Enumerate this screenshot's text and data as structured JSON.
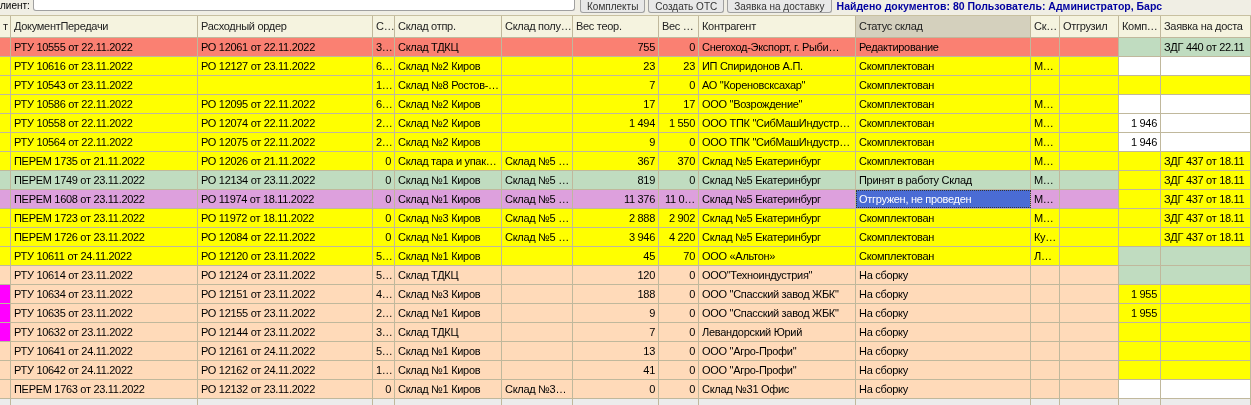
{
  "toolbar": {
    "label": "лиент:",
    "buttons": [
      "Комплекты",
      "Создать ОТС",
      "Заявка на доставку"
    ],
    "info": "Найдено документов: 80  Пользователь: Администратор, Барс"
  },
  "table": {
    "columns": [
      {
        "label": "т",
        "sorted": false
      },
      {
        "label": "ДокументПередачи",
        "sorted": false
      },
      {
        "label": "Расходный ордер",
        "sorted": false
      },
      {
        "label": "С…",
        "sorted": false
      },
      {
        "label": "Склад отпр.",
        "sorted": false
      },
      {
        "label": "Склад полу…",
        "sorted": false
      },
      {
        "label": "Вес теор.",
        "sorted": false
      },
      {
        "label": "Вес …",
        "sorted": false
      },
      {
        "label": "Контрагент",
        "sorted": false
      },
      {
        "label": "Статус склад",
        "sorted": true
      },
      {
        "label": "Ск…",
        "sorted": false
      },
      {
        "label": "Отгрузил",
        "sorted": false
      },
      {
        "label": "Комп…",
        "sorted": false
      },
      {
        "label": "Заявка на доста",
        "sorted": false
      }
    ],
    "rows": [
      {
        "color": "#fa8072",
        "marked": false,
        "komp_cell": {
          "color": "#c0dcc0"
        },
        "request_cell": {
          "color": "#c0dcc0"
        },
        "selected": false,
        "cells": [
          null,
          "РТУ 10555 от 22.11.2022",
          "РО 12061 от 22.11.2022",
          "3…",
          "Склад ТДКЦ",
          null,
          "755",
          "0",
          "Снегоход-Экспорт, г. Рыби…",
          "Редактирование",
          null,
          null,
          null,
          "ЗДГ 440 от 22.11"
        ]
      },
      {
        "color": "#ffff00",
        "marked": false,
        "komp_cell": {
          "color": "#ffffff"
        },
        "request_cell": {
          "color": "#ffffff"
        },
        "selected": false,
        "cells": [
          null,
          "РТУ 10616 от 23.11.2022",
          "РО 12127 от 23.11.2022",
          "6…",
          "Склад №2 Киров",
          null,
          "23",
          "23",
          "ИП Спиридонов А.П.",
          "Скомплектован",
          "М…",
          null,
          null,
          null
        ]
      },
      {
        "color": "#ffff00",
        "marked": false,
        "komp_cell": {
          "color": "#ffff00"
        },
        "request_cell": {
          "color": "#ffff00"
        },
        "selected": false,
        "cells": [
          null,
          "РТУ 10543 от 23.11.2022",
          null,
          "1…",
          "Склад №8 Ростов-…",
          null,
          "7",
          "0",
          "АО \"Кореновсксахар\"",
          "Скомплектован",
          null,
          null,
          null,
          null
        ]
      },
      {
        "color": "#ffff00",
        "marked": false,
        "komp_cell": {
          "color": "#ffffff"
        },
        "request_cell": {
          "color": "#ffffff"
        },
        "selected": false,
        "cells": [
          null,
          "РТУ 10586 от 22.11.2022",
          "РО 12095 от 22.11.2022",
          "6…",
          "Склад №2 Киров",
          null,
          "17",
          "17",
          "ООО \"Возрождение\"",
          "Скомплектован",
          "М…",
          null,
          null,
          null
        ]
      },
      {
        "color": "#ffff00",
        "marked": false,
        "komp_cell": {
          "color": "#ffffff"
        },
        "request_cell": {
          "color": "#ffffff"
        },
        "selected": false,
        "cells": [
          null,
          "РТУ 10558 от 22.11.2022",
          "РО 12074 от 22.11.2022",
          "2…",
          "Склад №2 Киров",
          null,
          "1 494",
          "1 550",
          "ООО ТПК \"СибМашИндустр…",
          "Скомплектован",
          "М…",
          null,
          "1 946",
          null
        ]
      },
      {
        "color": "#ffff00",
        "marked": false,
        "komp_cell": {
          "color": "#ffffff"
        },
        "request_cell": {
          "color": "#ffffff"
        },
        "selected": false,
        "cells": [
          null,
          "РТУ 10564 от 22.11.2022",
          "РО 12075 от 22.11.2022",
          "2…",
          "Склад №2 Киров",
          null,
          "9",
          "0",
          "ООО ТПК \"СибМашИндустр…",
          "Скомплектован",
          "М…",
          null,
          "1 946",
          null
        ]
      },
      {
        "color": "#ffff00",
        "marked": false,
        "komp_cell": {
          "color": "#ffff00"
        },
        "request_cell": {
          "color": "#ffff00"
        },
        "selected": false,
        "cells": [
          null,
          "ПЕРЕМ 1735 от 21.11.2022",
          "РО 12026 от 21.11.2022",
          "0",
          "Склад тара и упак…",
          "Склад №5 …",
          "367",
          "370",
          "Склад №5 Екатеринбург",
          "Скомплектован",
          "М…",
          null,
          null,
          "ЗДГ 437 от 18.11"
        ]
      },
      {
        "color": "#c0dcc0",
        "marked": false,
        "komp_cell": {
          "color": "#ffff00"
        },
        "request_cell": {
          "color": "#ffff00"
        },
        "selected": false,
        "cells": [
          null,
          "ПЕРЕМ 1749 от 23.11.2022",
          "РО 12134 от 23.11.2022",
          "0",
          "Склад №1 Киров",
          "Склад №5 …",
          "819",
          "0",
          "Склад №5 Екатеринбург",
          "Принят в работу Склад",
          "М…",
          null,
          null,
          "ЗДГ 437 от 18.11"
        ]
      },
      {
        "color": "#dda0dd",
        "marked": false,
        "komp_cell": {
          "color": "#ffff00"
        },
        "request_cell": {
          "color": "#ffff00"
        },
        "selected": true,
        "cells": [
          null,
          "ПЕРЕМ 1608 от 23.11.2022",
          "РО 11974 от 18.11.2022",
          "0",
          "Склад №1 Киров",
          "Склад №5 …",
          "11 376",
          "11 0…",
          "Склад №5 Екатеринбург",
          "Отгружен, не проведен",
          "М…",
          null,
          null,
          "ЗДГ 437 от 18.11"
        ]
      },
      {
        "color": "#ffff00",
        "marked": false,
        "komp_cell": {
          "color": "#ffff00"
        },
        "request_cell": {
          "color": "#ffff00"
        },
        "selected": false,
        "cells": [
          null,
          "ПЕРЕМ 1723 от 23.11.2022",
          "РО 11972 от 18.11.2022",
          "0",
          "Склад №3 Киров",
          "Склад №5 …",
          "2 888",
          "2 902",
          "Склад №5 Екатеринбург",
          "Скомплектован",
          "М…",
          null,
          null,
          "ЗДГ 437 от 18.11"
        ]
      },
      {
        "color": "#ffff00",
        "marked": false,
        "komp_cell": {
          "color": "#ffff00"
        },
        "request_cell": {
          "color": "#ffff00"
        },
        "selected": false,
        "cells": [
          null,
          "ПЕРЕМ 1726 от 23.11.2022",
          "РО 12084 от 22.11.2022",
          "0",
          "Склад №1 Киров",
          "Склад №5 …",
          "3 946",
          "4 220",
          "Склад №5 Екатеринбург",
          "Скомплектован",
          "Ку…",
          null,
          null,
          "ЗДГ 437 от 18.11"
        ]
      },
      {
        "color": "#ffff00",
        "marked": false,
        "komp_cell": {
          "color": "#c0dcc0"
        },
        "request_cell": {
          "color": "#c0dcc0"
        },
        "selected": false,
        "cells": [
          null,
          "РТУ 10611 от 24.11.2022",
          "РО 12120 от 23.11.2022",
          "5…",
          "Склад №1 Киров",
          null,
          "45",
          "70",
          "ООО «Альтон»",
          "Скомплектован",
          "Л…",
          null,
          null,
          null
        ]
      },
      {
        "color": "#ffdab9",
        "marked": false,
        "komp_cell": {
          "color": "#c0dcc0"
        },
        "request_cell": {
          "color": "#c0dcc0"
        },
        "selected": false,
        "cells": [
          null,
          "РТУ 10614 от 23.11.2022",
          "РО 12124 от 23.11.2022",
          "5…",
          "Склад ТДКЦ",
          null,
          "120",
          "0",
          "ООО\"Техноиндустрия\"",
          "На сборку",
          null,
          null,
          null,
          null
        ]
      },
      {
        "color": "#ffdab9",
        "marked": true,
        "komp_cell": {
          "color": "#ffff00"
        },
        "request_cell": {
          "color": "#ffff00"
        },
        "selected": false,
        "cells": [
          null,
          "РТУ 10634 от 23.11.2022",
          "РО 12151 от 23.11.2022",
          "4…",
          "Склад №3 Киров",
          null,
          "188",
          "0",
          "ООО \"Спасский завод ЖБК\"",
          "На сборку",
          null,
          null,
          "1 955",
          null
        ]
      },
      {
        "color": "#ffdab9",
        "marked": true,
        "komp_cell": {
          "color": "#ffff00"
        },
        "request_cell": {
          "color": "#ffff00"
        },
        "selected": false,
        "cells": [
          null,
          "РТУ 10635 от 23.11.2022",
          "РО 12155 от 23.11.2022",
          "2…",
          "Склад №1 Киров",
          null,
          "9",
          "0",
          "ООО \"Спасский завод ЖБК\"",
          "На сборку",
          null,
          null,
          "1 955",
          null
        ]
      },
      {
        "color": "#ffdab9",
        "marked": true,
        "komp_cell": {
          "color": "#ffff00"
        },
        "request_cell": {
          "color": "#ffff00"
        },
        "selected": false,
        "cells": [
          null,
          "РТУ 10632 от 23.11.2022",
          "РО 12144 от 23.11.2022",
          "3…",
          "Склад ТДКЦ",
          null,
          "7",
          "0",
          "Левандорский Юрий",
          "На сборку",
          null,
          null,
          null,
          null
        ]
      },
      {
        "color": "#ffdab9",
        "marked": false,
        "komp_cell": {
          "color": "#ffff00"
        },
        "request_cell": {
          "color": "#ffff00"
        },
        "selected": false,
        "cells": [
          null,
          "РТУ 10641 от 24.11.2022",
          "РО 12161 от 24.11.2022",
          "5…",
          "Склад №1 Киров",
          null,
          "13",
          "0",
          "ООО \"Агро-Профи\"",
          "На сборку",
          null,
          null,
          null,
          null
        ]
      },
      {
        "color": "#ffdab9",
        "marked": false,
        "komp_cell": {
          "color": "#ffff00"
        },
        "request_cell": {
          "color": "#ffff00"
        },
        "selected": false,
        "cells": [
          null,
          "РТУ 10642 от 24.11.2022",
          "РО 12162 от 24.11.2022",
          "1…",
          "Склад №1 Киров",
          null,
          "41",
          "0",
          "ООО \"Агро-Профи\"",
          "На сборку",
          null,
          null,
          null,
          null
        ]
      },
      {
        "color": "#ffdab9",
        "marked": false,
        "komp_cell": {
          "color": "#ffffff"
        },
        "request_cell": {
          "color": "#ffffff"
        },
        "selected": false,
        "cells": [
          null,
          "ПЕРЕМ 1763 от 23.11.2022",
          "РО 12132 от 23.11.2022",
          "0",
          "Склад №1 Киров",
          "Склад №3…",
          "0",
          "0",
          "Склад №31 Офис",
          "На сборку",
          null,
          null,
          null,
          null
        ]
      }
    ]
  }
}
